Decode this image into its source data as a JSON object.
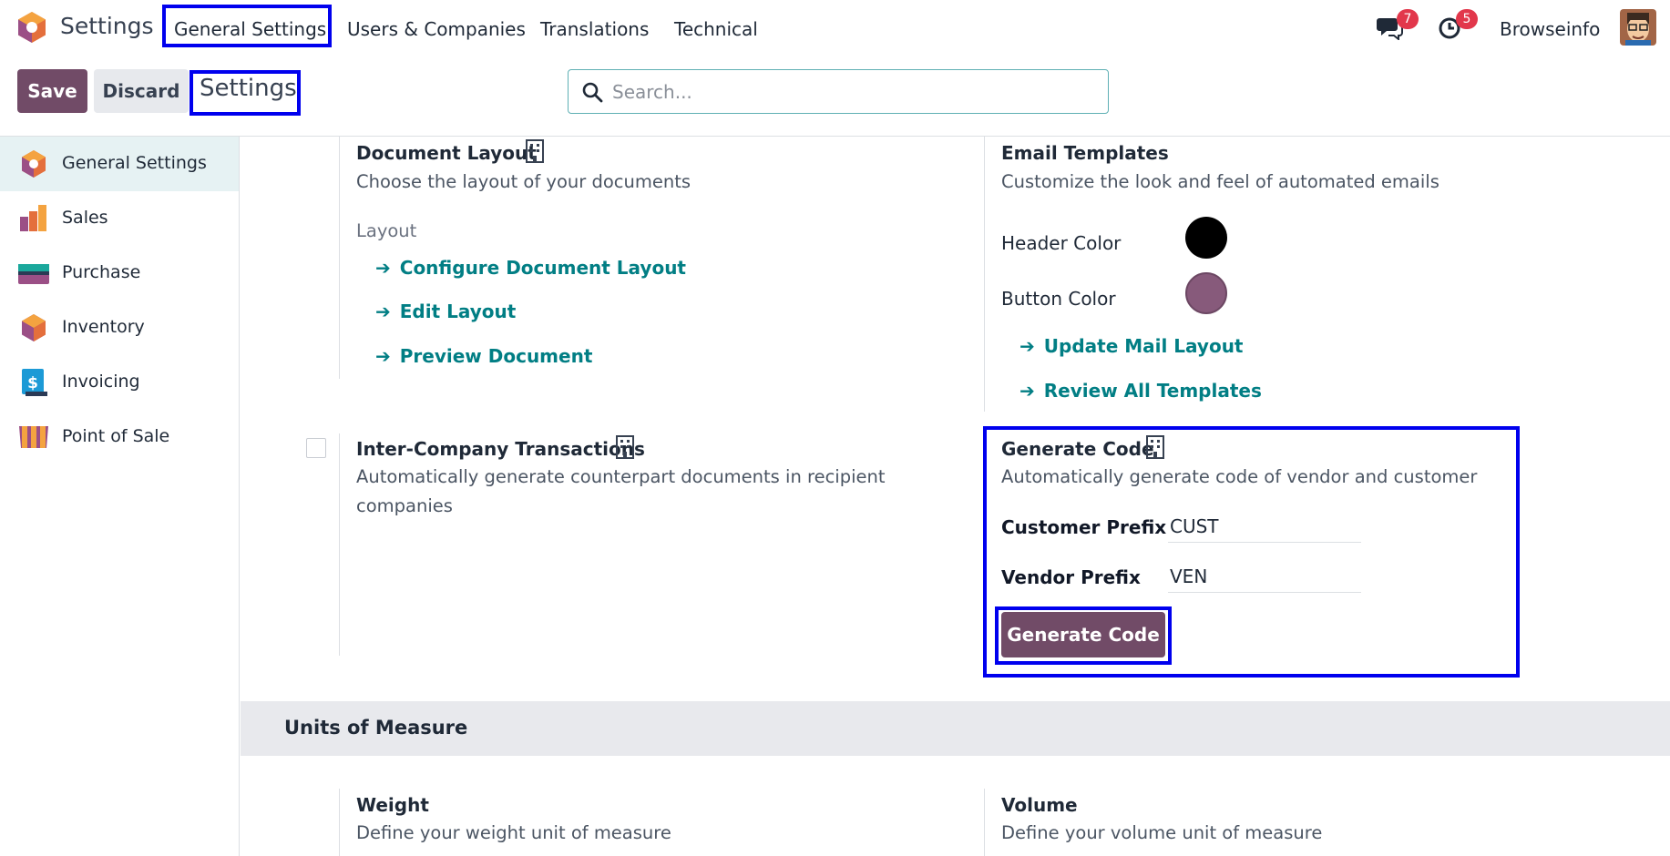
{
  "app": {
    "title": "Settings"
  },
  "menu": {
    "items": [
      {
        "label": "General Settings"
      },
      {
        "label": "Users & Companies"
      },
      {
        "label": "Translations"
      },
      {
        "label": "Technical"
      }
    ]
  },
  "systray": {
    "messages_count": "7",
    "activities_count": "5",
    "user_name": "Browseinfo"
  },
  "controls": {
    "save_label": "Save",
    "discard_label": "Discard",
    "breadcrumb": "Settings"
  },
  "search": {
    "placeholder": "Search..."
  },
  "sidebar": {
    "items": [
      {
        "label": "General Settings",
        "active": true
      },
      {
        "label": "Sales"
      },
      {
        "label": "Purchase"
      },
      {
        "label": "Inventory"
      },
      {
        "label": "Invoicing"
      },
      {
        "label": "Point of Sale"
      }
    ]
  },
  "doc_layout": {
    "title": "Document Layout",
    "description": "Choose the layout of your documents",
    "layout_label": "Layout",
    "links": [
      "Configure Document Layout",
      "Edit Layout",
      "Preview Document"
    ]
  },
  "email_templates": {
    "title": "Email Templates",
    "description": "Customize the look and feel of automated emails",
    "header_color_label": "Header Color",
    "header_color": "#000000",
    "button_color_label": "Button Color",
    "button_color": "#875a7b",
    "links": [
      "Update Mail Layout",
      "Review All Templates"
    ]
  },
  "inter_company": {
    "title": "Inter-Company Transactions",
    "description_line1": "Automatically generate counterpart documents in recipient",
    "description_line2": "companies"
  },
  "generate_code": {
    "title": "Generate Code",
    "description": "Automatically generate code of vendor and customer",
    "customer_prefix_label": "Customer Prefix",
    "customer_prefix_value": "CUST",
    "vendor_prefix_label": "Vendor Prefix",
    "vendor_prefix_value": "VEN",
    "button_label": "Generate Code"
  },
  "units_section": {
    "title": "Units of Measure"
  },
  "weight": {
    "title": "Weight",
    "description": "Define your weight unit of measure"
  },
  "volume": {
    "title": "Volume",
    "description": "Define your volume unit of measure"
  },
  "colors": {
    "brand": "#714b67",
    "link": "#017e84",
    "highlight": "#0000ee",
    "badge": "#e2374b"
  }
}
